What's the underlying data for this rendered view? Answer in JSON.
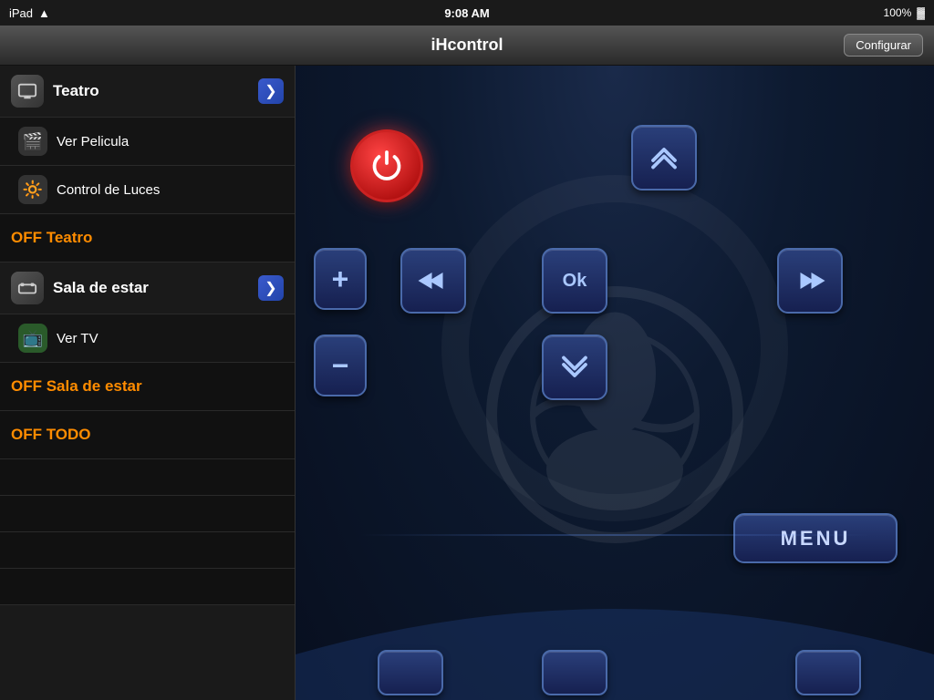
{
  "statusBar": {
    "carrier": "iPad",
    "wifi": "wifi",
    "time": "9:08 AM",
    "battery": "100%"
  },
  "navBar": {
    "title": "iHcontrol",
    "configButton": "Configurar"
  },
  "sidebar": {
    "sections": [
      {
        "id": "teatro",
        "label": "Teatro",
        "icon": "tv",
        "subItems": [
          {
            "id": "ver-pelicula",
            "label": "Ver Pelicula",
            "icon": "film"
          },
          {
            "id": "control-luces",
            "label": "Control de Luces",
            "icon": "light"
          }
        ],
        "offButton": "OFF Teatro"
      },
      {
        "id": "sala",
        "label": "Sala de estar",
        "icon": "sofa",
        "subItems": [
          {
            "id": "ver-tv",
            "label": "Ver TV",
            "icon": "tv2"
          }
        ],
        "offButton": "OFF Sala de estar"
      }
    ],
    "offAll": "OFF TODO"
  },
  "remote": {
    "buttons": {
      "power": "power",
      "up": "↑↑",
      "rewind": "«",
      "ok": "Ok",
      "forward": "»",
      "volPlus": "+",
      "volMinus": "−",
      "down": "↓↓",
      "menu": "MENU"
    }
  }
}
